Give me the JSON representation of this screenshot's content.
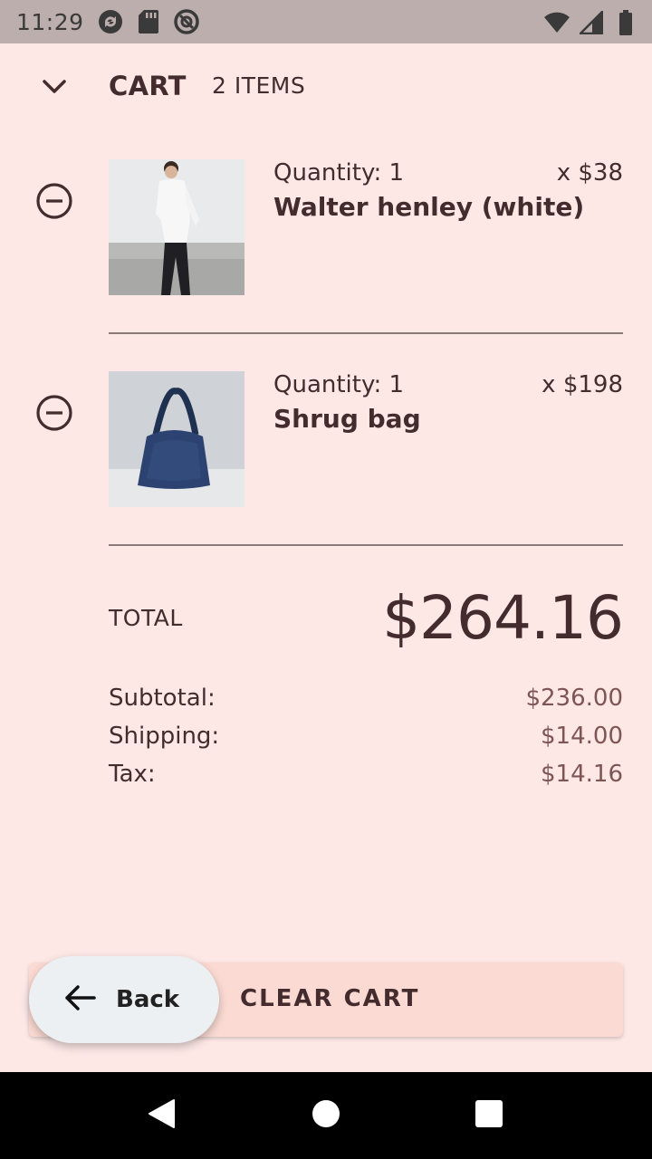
{
  "status_bar": {
    "time": "11:29",
    "left_icons": [
      "sync-icon",
      "sd-card-icon",
      "at-sign-icon"
    ],
    "right_icons": [
      "wifi-icon",
      "signal-icon",
      "battery-icon"
    ]
  },
  "header": {
    "title": "CART",
    "item_count": "2 ITEMS"
  },
  "items": [
    {
      "quantity": "Quantity: 1",
      "price": "x $38",
      "name": "Walter henley (white)",
      "image": "man-in-white-henley-photo"
    },
    {
      "quantity": "Quantity: 1",
      "price": "x $198",
      "name": "Shrug bag",
      "image": "navy-shoulder-bag-photo"
    }
  ],
  "totals": {
    "total_label": "TOTAL",
    "total_value": "$264.16",
    "rows": [
      {
        "label": "Subtotal:",
        "value": "$236.00"
      },
      {
        "label": "Shipping:",
        "value": "$14.00"
      },
      {
        "label": "Tax:",
        "value": "$14.16"
      }
    ]
  },
  "actions": {
    "clear_cart": "CLEAR CART",
    "back": "Back"
  },
  "colors": {
    "background": "#fde8e6",
    "text": "#442c2e",
    "accent_button": "#fbdad3",
    "fab": "#edf0f2"
  }
}
